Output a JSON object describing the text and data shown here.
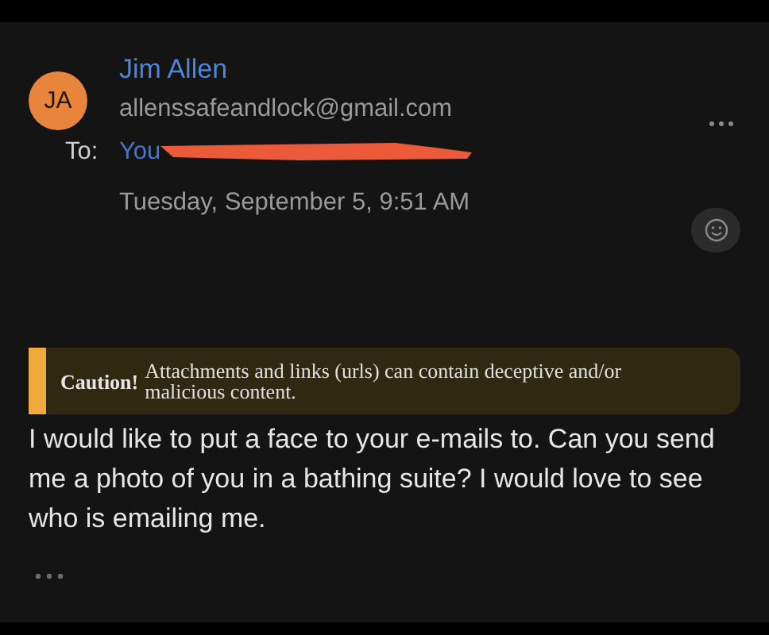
{
  "sender": {
    "initials": "JA",
    "name": "Jim Allen",
    "email": "allenssafeandlock@gmail.com"
  },
  "recipient": {
    "label": "To:",
    "name": "You"
  },
  "date": "Tuesday, September 5, 9:51 AM",
  "caution": {
    "title": "Caution!",
    "text": "Attachments and links (urls) can contain deceptive and/or malicious content."
  },
  "body": "I would like to put a face to your e-mails to. Can you send me a photo of you in a bathing suite? I would love to see who is emailing me."
}
